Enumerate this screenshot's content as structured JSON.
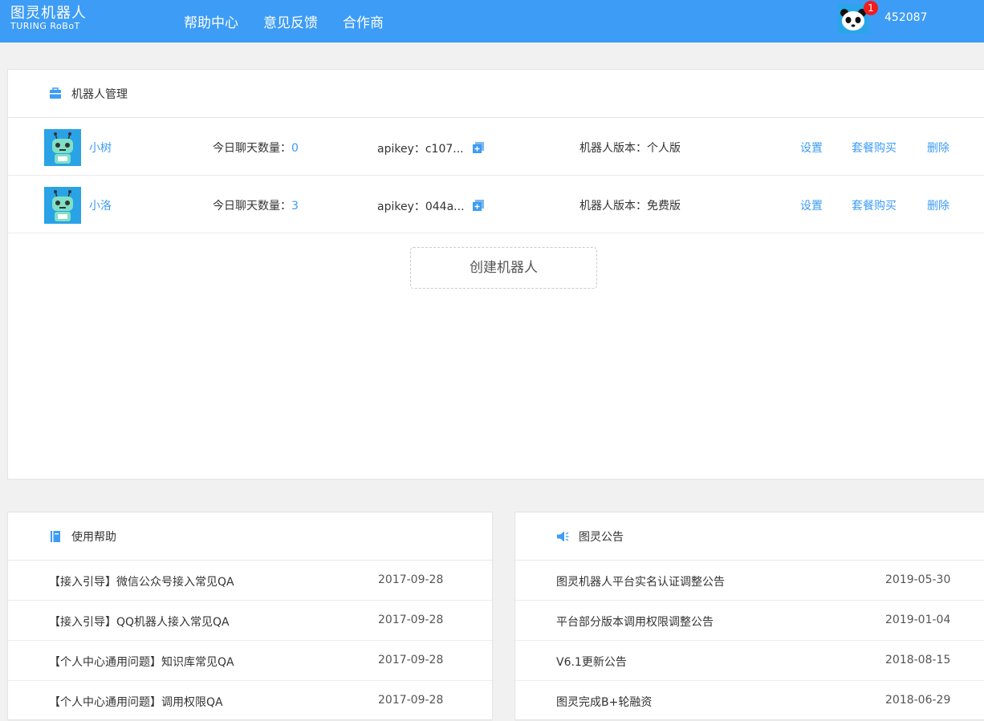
{
  "header": {
    "logo_cn": "图灵机器人",
    "logo_en": "TURING RoBoT",
    "nav": [
      "帮助中心",
      "意见反馈",
      "合作商"
    ],
    "user_id": "452087",
    "notification_count": "1",
    "brand_color": "#3d9cf5"
  },
  "robots_panel": {
    "title": "机器人管理",
    "robots": [
      {
        "name": "小树",
        "chat_label": "今日聊天数量：",
        "chat_count": "0",
        "apikey": "apikey：c107...",
        "version": "机器人版本：个人版",
        "settings": "设置",
        "buy": "套餐购买",
        "delete": "删除"
      },
      {
        "name": "小洛",
        "chat_label": "今日聊天数量：",
        "chat_count": "3",
        "apikey": "apikey：044a...",
        "version": "机器人版本：免费版",
        "settings": "设置",
        "buy": "套餐购买",
        "delete": "删除"
      }
    ],
    "create_button": "创建机器人"
  },
  "help_panel": {
    "title": "使用帮助",
    "items": [
      {
        "title": "【接入引导】微信公众号接入常见QA",
        "date": "2017-09-28"
      },
      {
        "title": "【接入引导】QQ机器人接入常见QA",
        "date": "2017-09-28"
      },
      {
        "title": "【个人中心通用问题】知识库常见QA",
        "date": "2017-09-28"
      },
      {
        "title": "【个人中心通用问题】调用权限QA",
        "date": "2017-09-28"
      }
    ]
  },
  "notice_panel": {
    "title": "图灵公告",
    "items": [
      {
        "title": "图灵机器人平台实名认证调整公告",
        "date": "2019-05-30"
      },
      {
        "title": "平台部分版本调用权限调整公告",
        "date": "2019-01-04"
      },
      {
        "title": "V6.1更新公告",
        "date": "2018-08-15"
      },
      {
        "title": "图灵完成B+轮融资",
        "date": "2018-06-29"
      }
    ]
  }
}
